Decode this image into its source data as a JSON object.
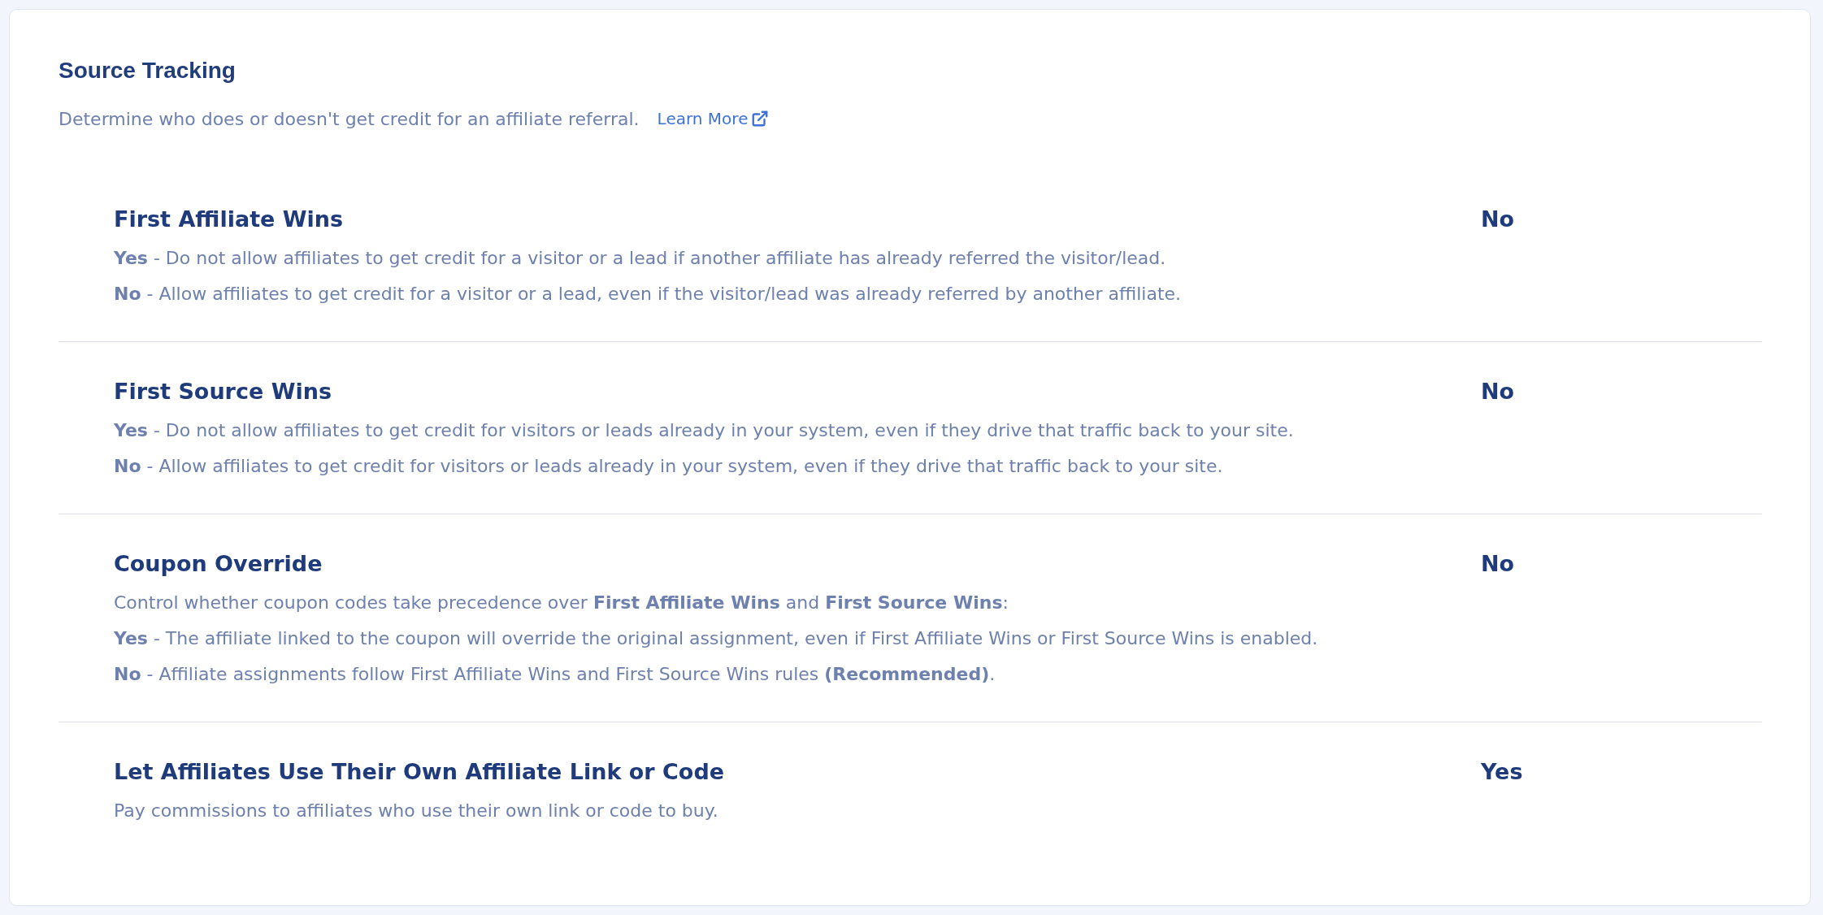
{
  "panel": {
    "title": "Source Tracking",
    "description": "Determine who does or doesn't get credit for an affiliate referral.",
    "link": {
      "label": "Learn More"
    }
  },
  "settings": [
    {
      "title": "First Affiliate Wins",
      "value": "No",
      "lines": [
        "**Yes** - Do not allow affiliates to get credit for a visitor or a lead if another affiliate has already referred the visitor/lead.",
        "**No** - Allow affiliates to get credit for a visitor or a lead, even if the visitor/lead was already referred by another affiliate."
      ]
    },
    {
      "title": "First Source Wins",
      "value": "No",
      "lines": [
        "**Yes** - Do not allow affiliates to get credit for visitors or leads already in your system, even if they drive that traffic back to your site.",
        "**No** - Allow affiliates to get credit for visitors or leads already in your system, even if they drive that traffic back to your site."
      ]
    },
    {
      "title": "Coupon Override",
      "value": "No",
      "lines": [
        "Control whether coupon codes take precedence over **First Affiliate Wins** and **First Source Wins**:",
        "**Yes** - The affiliate linked to the coupon will override the original assignment, even if First Affiliate Wins or First Source Wins is enabled.",
        "**No** - Affiliate assignments follow First Affiliate Wins and First Source Wins rules **(Recommended)**."
      ]
    },
    {
      "title": "Let Affiliates Use Their Own Affiliate Link or Code",
      "value": "Yes",
      "lines": [
        "Pay commissions to affiliates who use their own link or code to buy."
      ]
    }
  ]
}
